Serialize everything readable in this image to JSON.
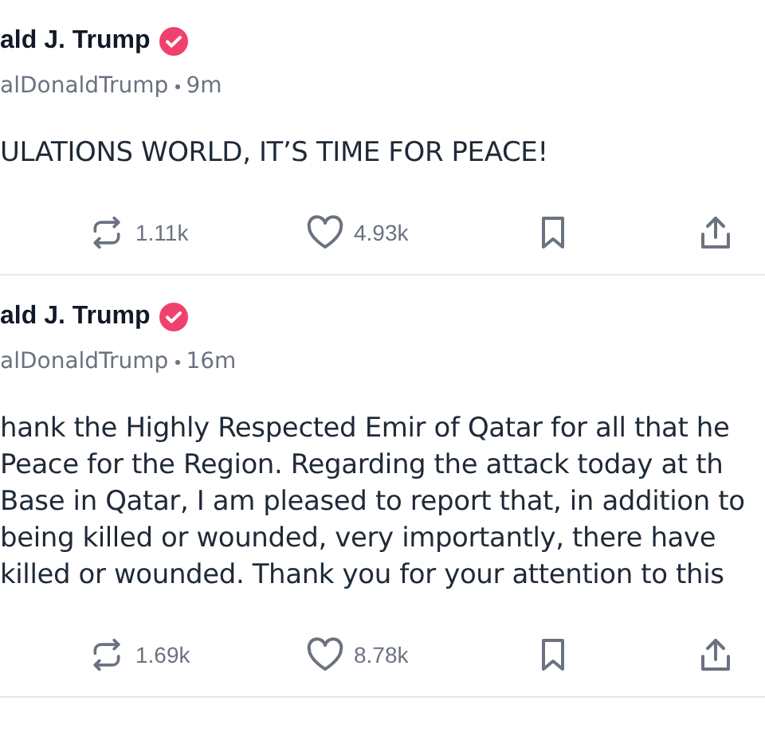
{
  "posts": [
    {
      "name": "ald J. Trump",
      "verified": true,
      "handle": "alDonaldTrump",
      "time": "9m",
      "body": [
        "ULATIONS WORLD, IT’S TIME FOR PEACE!"
      ],
      "reposts": "1.11k",
      "likes": "4.93k"
    },
    {
      "name": "ald J. Trump",
      "verified": true,
      "handle": "alDonaldTrump",
      "time": "16m",
      "body": [
        "hank the Highly Respected Emir of Qatar for all that he",
        "Peace for the Region. Regarding the attack today at th",
        "Base in Qatar, I am pleased to report that, in addition to",
        "being killed or wounded, very importantly, there have",
        "killed or wounded. Thank you for your attention to this"
      ],
      "reposts": "1.69k",
      "likes": "8.78k"
    }
  ]
}
